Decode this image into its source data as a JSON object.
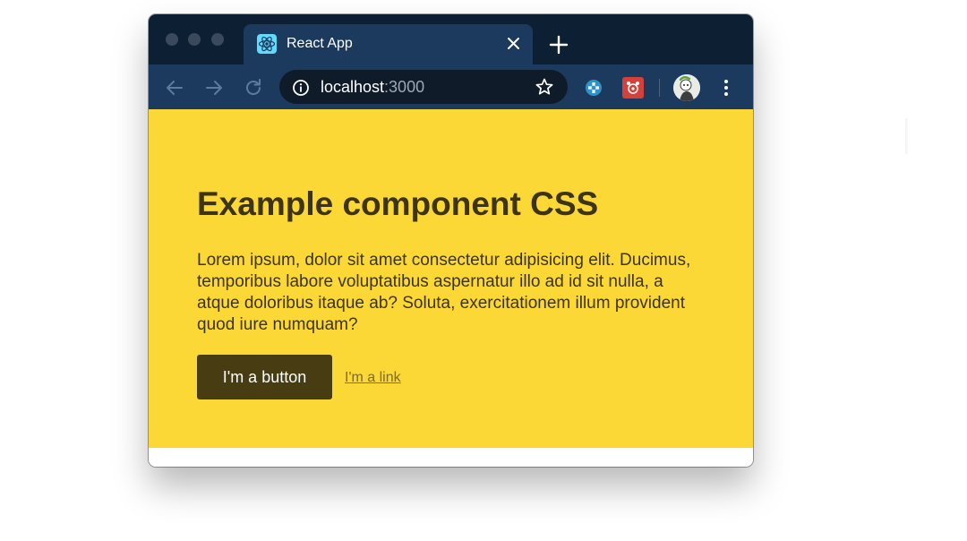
{
  "browser": {
    "tab": {
      "title": "React App",
      "favicon": "react-logo-icon"
    },
    "address_bar": {
      "host": "localhost",
      "port": ":3000"
    },
    "icons": {
      "back": "back-arrow-icon",
      "forward": "forward-arrow-icon",
      "reload": "reload-icon",
      "info": "info-icon",
      "bookmark": "star-icon",
      "extension_1": "puzzle-extension-icon",
      "extension_2": "red-extension-icon",
      "profile": "avatar",
      "menu": "kebab-menu-icon",
      "close_tab": "close-icon",
      "new_tab": "plus-icon"
    },
    "colors": {
      "frame": "#0d1f33",
      "toolbar": "#1b3a5e",
      "omnibox": "#0f1b28"
    }
  },
  "page": {
    "title": "Example component CSS",
    "body": "Lorem ipsum, dolor sit amet consectetur adipisicing elit. Ducimus, temporibus labore voluptatibus aspernatur illo ad id sit nulla, a atque doloribus itaque ab? Soluta, exercitationem illum provident quod iure numquam?",
    "button_label": "I'm a button",
    "link_label": "I'm a link",
    "colors": {
      "background": "#fbd836",
      "text": "#3d3417",
      "button": "#483c13",
      "link": "#7a6b2e"
    }
  }
}
